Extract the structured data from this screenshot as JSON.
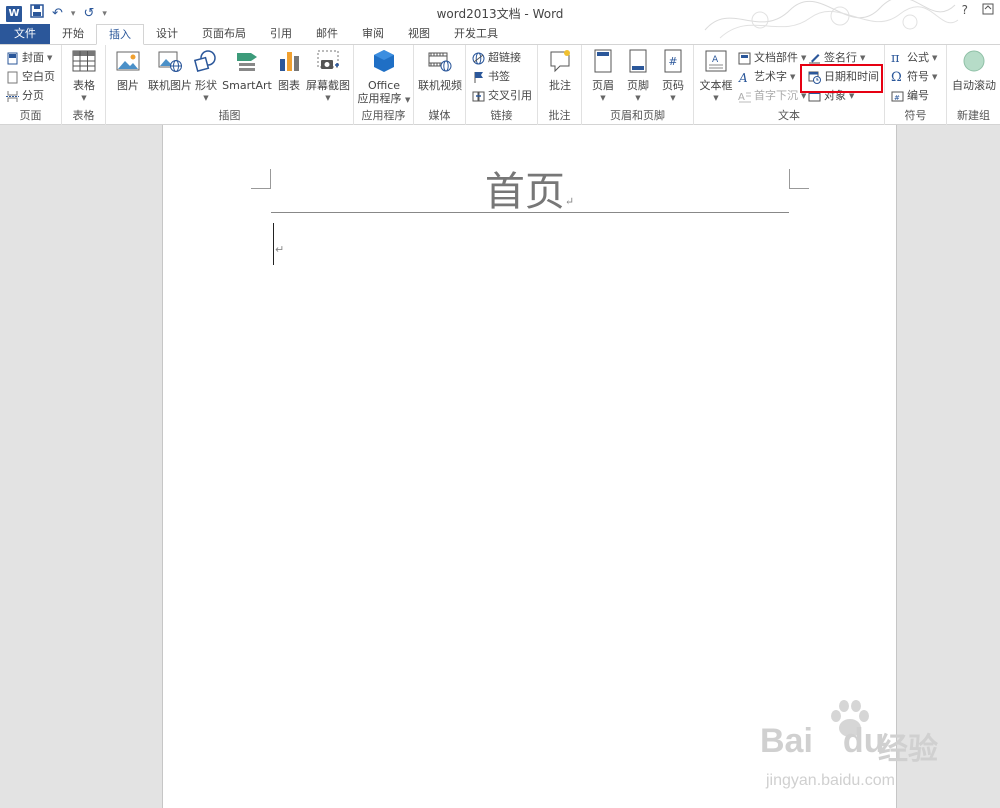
{
  "window": {
    "title": "word2013文档 - Word",
    "help_label": "?",
    "qat": {
      "undo_symbol": "↶",
      "redo_symbol": "↺",
      "customize_symbol": "▾"
    }
  },
  "tabs": [
    {
      "label": "文件"
    },
    {
      "label": "开始"
    },
    {
      "label": "插入"
    },
    {
      "label": "设计"
    },
    {
      "label": "页面布局"
    },
    {
      "label": "引用"
    },
    {
      "label": "邮件"
    },
    {
      "label": "审阅"
    },
    {
      "label": "视图"
    },
    {
      "label": "开发工具"
    }
  ],
  "active_tab": "插入",
  "ribbon": {
    "pages": {
      "label": "页面",
      "cover": "封面",
      "blank": "空白页",
      "break": "分页"
    },
    "tables": {
      "label": "表格",
      "table": "表格"
    },
    "illustrations": {
      "label": "插图",
      "picture": "图片",
      "online_picture": "联机图片",
      "shapes": "形状",
      "smartart": "SmartArt",
      "chart": "图表",
      "screenshot": "屏幕截图"
    },
    "apps": {
      "label": "应用程序",
      "office_line1": "Office",
      "office_line2": "应用程序"
    },
    "media": {
      "label": "媒体",
      "online_video": "联机视频"
    },
    "links": {
      "label": "链接",
      "hyperlink": "超链接",
      "bookmark": "书签",
      "cross_ref": "交叉引用"
    },
    "comments": {
      "label": "批注",
      "comment": "批注"
    },
    "header_footer": {
      "label": "页眉和页脚",
      "header": "页眉",
      "footer": "页脚",
      "page_number": "页码"
    },
    "text": {
      "label": "文本",
      "textbox": "文本框",
      "quick_parts": "文档部件",
      "wordart": "艺术字",
      "dropcap": "首字下沉",
      "signature": "签名行",
      "datetime": "日期和时间",
      "object": "对象"
    },
    "symbols": {
      "label": "符号",
      "equation": "公式",
      "symbol": "符号",
      "numbering": "编号"
    },
    "newgroup": {
      "label": "新建组",
      "autoscroll": "自动滚动"
    }
  },
  "document": {
    "header_text": "首页",
    "paragraph_mark": "↵"
  },
  "watermark": {
    "brand": "Bai",
    "brand2": "du",
    "chinese": "经验",
    "url": "jingyan.baidu.com"
  },
  "colors": {
    "accent": "#2b579a",
    "highlight": "#e60012"
  }
}
